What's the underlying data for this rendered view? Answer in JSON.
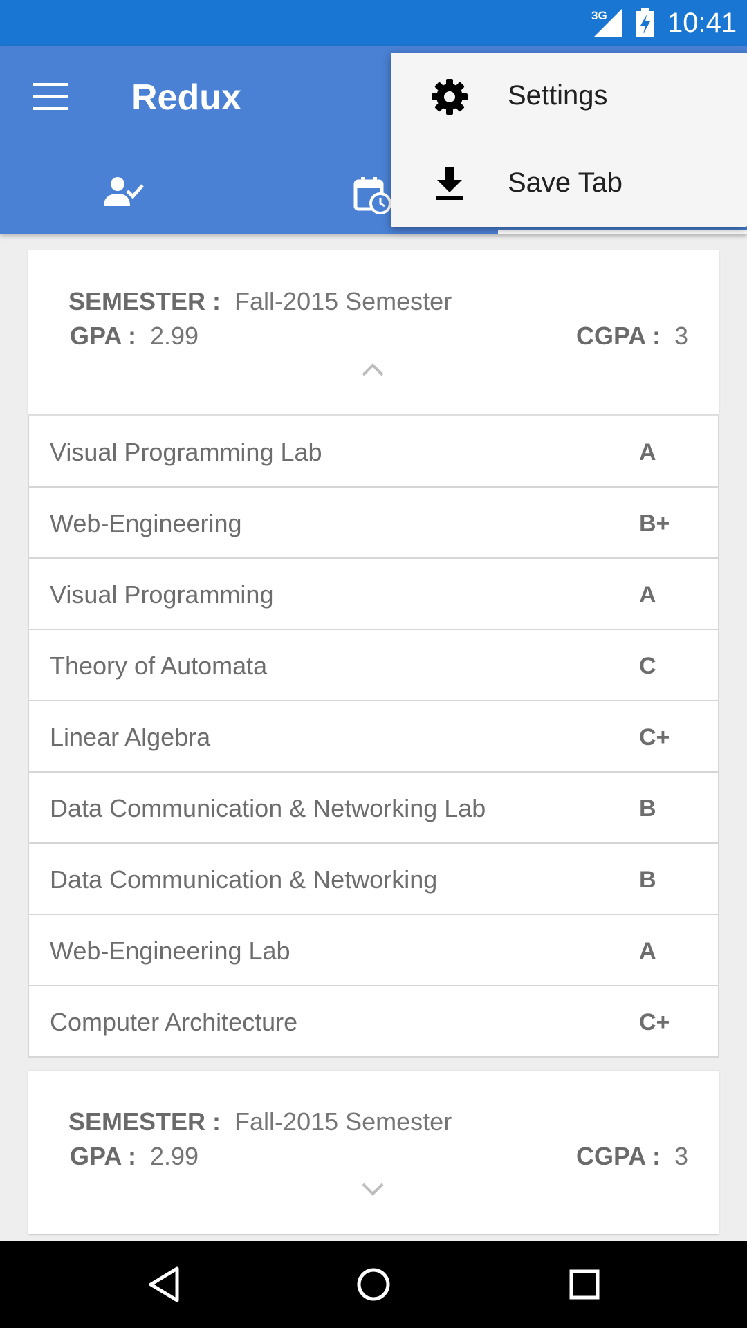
{
  "status_bar": {
    "network": "3G",
    "time": "10:41"
  },
  "app_bar": {
    "title": "Redux",
    "tabs": [
      {
        "icon": "person-check-icon"
      },
      {
        "icon": "calendar-clock-icon"
      },
      {
        "icon": "other-tab-icon"
      }
    ],
    "selected_tab": 3
  },
  "overflow_menu": {
    "items": [
      {
        "label": "Settings",
        "icon": "gear-icon"
      },
      {
        "label": "Save Tab",
        "icon": "download-icon"
      }
    ]
  },
  "semester_cards": [
    {
      "semester_label": "SEMESTER :",
      "semester_value": "Fall-2015 Semester",
      "gpa_label": "GPA :",
      "gpa_value": "2.99",
      "cgpa_label": "CGPA :",
      "cgpa_value": "3",
      "expanded": true
    },
    {
      "semester_label": "SEMESTER :",
      "semester_value": "Fall-2015 Semester",
      "gpa_label": "GPA :",
      "gpa_value": "2.99",
      "cgpa_label": "CGPA :",
      "cgpa_value": "3",
      "expanded": false
    }
  ],
  "courses": [
    {
      "name": "Visual Programming Lab",
      "grade": "A"
    },
    {
      "name": "Web-Engineering",
      "grade": "B+"
    },
    {
      "name": "Visual Programming",
      "grade": "A"
    },
    {
      "name": "Theory of Automata",
      "grade": "C"
    },
    {
      "name": "Linear Algebra",
      "grade": "C+"
    },
    {
      "name": "Data Communication & Networking Lab",
      "grade": "B"
    },
    {
      "name": "Data Communication & Networking",
      "grade": "B"
    },
    {
      "name": "Web-Engineering Lab",
      "grade": "A"
    },
    {
      "name": "Computer Architecture",
      "grade": "C+"
    }
  ],
  "colors": {
    "status_bar": "#1976d2",
    "app_bar": "#4a81d4",
    "background": "#eeeeee"
  }
}
